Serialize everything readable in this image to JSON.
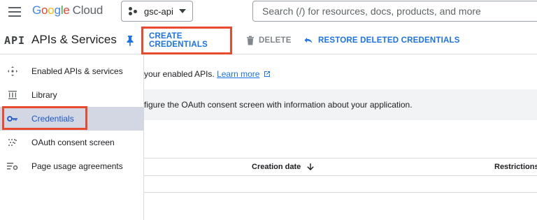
{
  "header": {
    "logo_letters": [
      "G",
      "o",
      "o",
      "g",
      "l",
      "e"
    ],
    "logo_suffix": "Cloud",
    "project": "gsc-api",
    "search_placeholder": "Search (/) for resources, docs, products, and more"
  },
  "toolbar": {
    "api_badge": "API",
    "section_title": "APIs & Services",
    "create_label": "CREATE CREDENTIALS",
    "delete_label": "DELETE",
    "restore_label": "RESTORE DELETED CREDENTIALS"
  },
  "sidebar": {
    "items": [
      {
        "label": "Enabled APIs & services",
        "icon": "diamond-arrows-icon"
      },
      {
        "label": "Library",
        "icon": "library-icon"
      },
      {
        "label": "Credentials",
        "icon": "key-icon",
        "active": true
      },
      {
        "label": "OAuth consent screen",
        "icon": "oauth-dots-icon"
      },
      {
        "label": "Page usage agreements",
        "icon": "settings-list-icon"
      }
    ]
  },
  "main": {
    "intro_text": "your enabled APIs. ",
    "intro_link": "Learn more",
    "banner_text": "figure the OAuth consent screen with information about your application.",
    "table": {
      "columns": [
        "Creation date",
        "Restrictions"
      ]
    }
  },
  "colors": {
    "accent": "#1a73e8",
    "highlight": "#e84a2f",
    "active_bg": "#d2d7e3"
  }
}
